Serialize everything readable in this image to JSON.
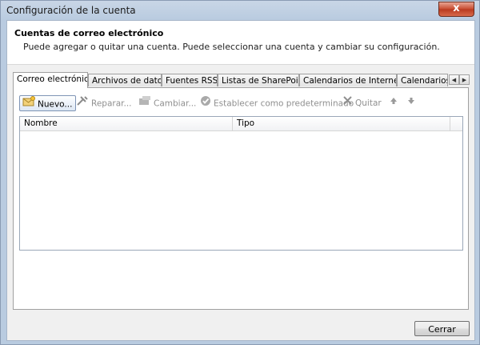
{
  "window": {
    "title": "Configuración de la cuenta",
    "close_glyph": "x"
  },
  "header": {
    "title": "Cuentas de correo electrónico",
    "description": "Puede agregar o quitar una cuenta. Puede seleccionar una cuenta y cambiar su configuración."
  },
  "tabs": [
    {
      "label": "Correo electrónico",
      "active": true
    },
    {
      "label": "Archivos de datos",
      "active": false
    },
    {
      "label": "Fuentes RSS",
      "active": false
    },
    {
      "label": "Listas de SharePoint",
      "active": false
    },
    {
      "label": "Calendarios de Internet",
      "active": false
    },
    {
      "label": "Calendarios p",
      "active": false
    }
  ],
  "tab_scroll": {
    "left": "◀",
    "right": "▶"
  },
  "toolbar": {
    "new_label": "Nuevo...",
    "repair_label": "Reparar...",
    "change_label": "Cambiar...",
    "set_default_label": "Establecer como predeterminado",
    "remove_label": "Quitar",
    "icons": [
      "new-account-icon",
      "repair-icon",
      "change-icon",
      "set-default-icon",
      "remove-icon",
      "move-up-icon",
      "move-down-icon"
    ]
  },
  "list": {
    "columns": [
      "Nombre",
      "Tipo"
    ],
    "rows": []
  },
  "footer": {
    "close_label": "Cerrar"
  }
}
